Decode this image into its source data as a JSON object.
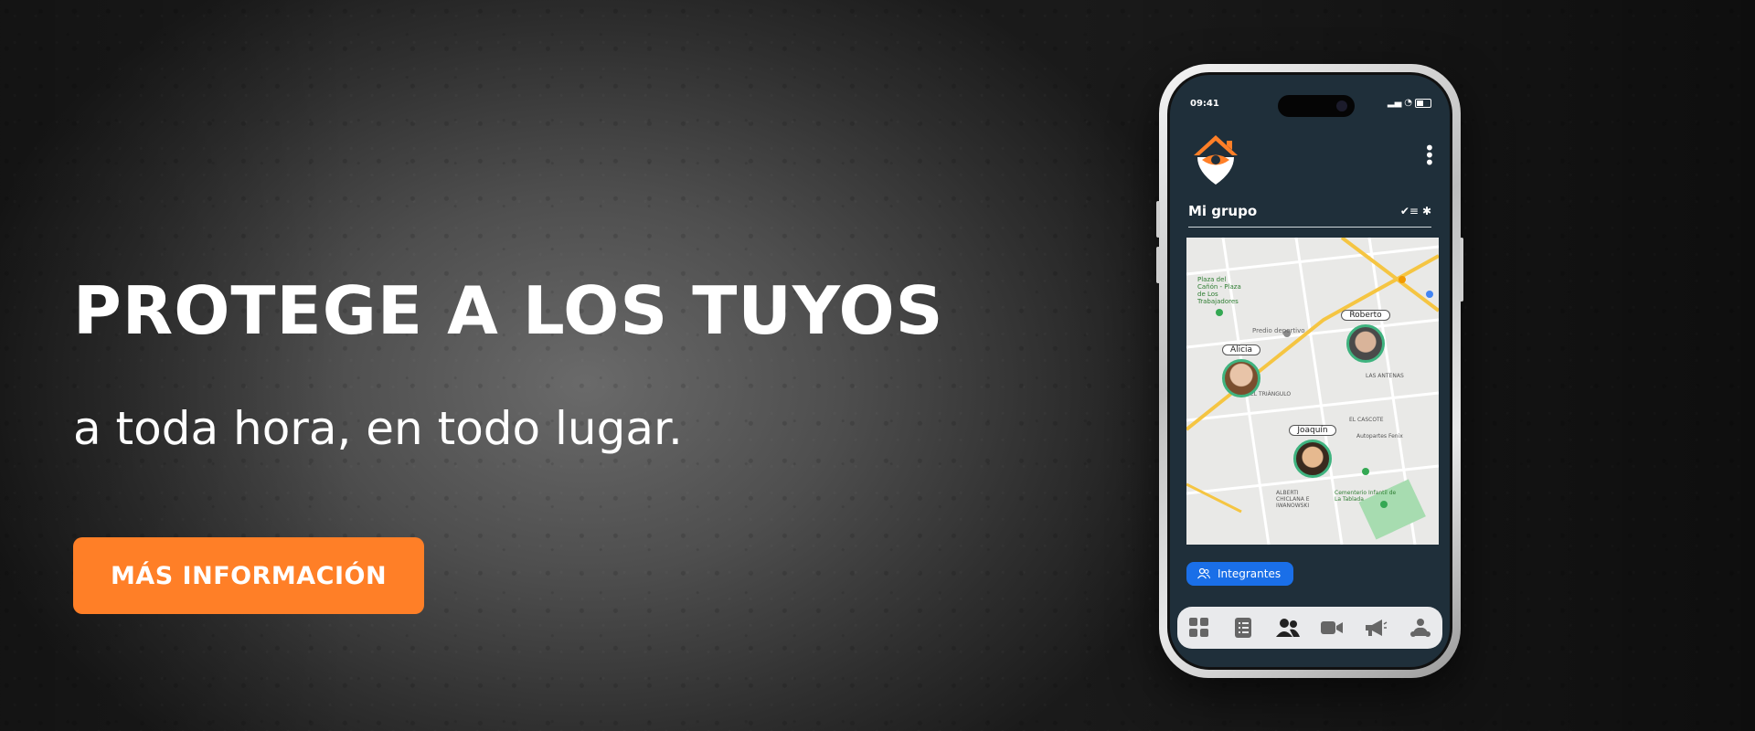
{
  "hero": {
    "headline": "PROTEGE A LOS TUYOS",
    "subline": "a toda hora, en todo lugar.",
    "cta_label": "MÁS INFORMACIÓN"
  },
  "colors": {
    "accent": "#ff7f27",
    "screen_bg": "#1f2f3a",
    "pill_blue": "#1a6fe8"
  },
  "phone": {
    "status_time": "09:41",
    "group_title": "Mi grupo",
    "map": {
      "people": [
        {
          "name": "Alicia"
        },
        {
          "name": "Roberto"
        },
        {
          "name": "Joaquín"
        }
      ],
      "places": [
        "Plaza del Cañón - Plaza de Los Trabajadores",
        "Predio deportivo",
        "EL TRIÁNGULO",
        "ALBERTI CHICLANA E IWANOWSKI",
        "LAS ANTENAS",
        "EL CASCOTE",
        "Autopartes Fenix",
        "Cementerio Infantil de La Tablada"
      ]
    },
    "members_button": "Integrantes",
    "tabs": [
      {
        "icon": "grid-icon"
      },
      {
        "icon": "list-icon"
      },
      {
        "icon": "group-icon"
      },
      {
        "icon": "video-camera-icon"
      },
      {
        "icon": "megaphone-icon"
      },
      {
        "icon": "pet-icon"
      }
    ]
  }
}
